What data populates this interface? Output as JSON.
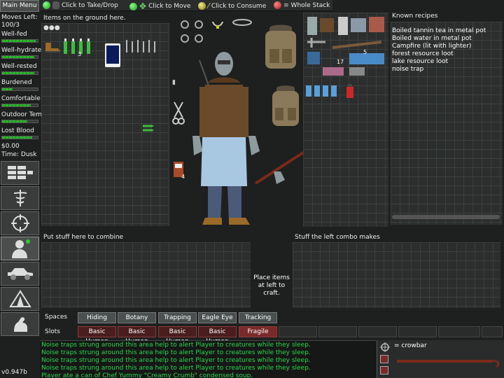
{
  "hints": [
    {
      "label": "Click to Take/Drop",
      "color": "#3bd23b"
    },
    {
      "label": "Click to Move",
      "color": "#3bd23b"
    },
    {
      "label": "Click to Consume",
      "color": "#c9b23a"
    },
    {
      "label": "Whole Stack",
      "color": "#d23b3b"
    }
  ],
  "sidebar": {
    "menu_label": "Main Menu",
    "moves_label": "Moves Left:",
    "moves_value": "100/3",
    "stats": [
      {
        "label": "Well-fed",
        "level": 0.95
      },
      {
        "label": "Well-hydrate",
        "level": 0.9
      },
      {
        "label": "Well-rested",
        "level": 0.9
      },
      {
        "label": "Burdened",
        "level": 0.3
      },
      {
        "label": "Comfortable",
        "level": 0.8
      },
      {
        "label": "Outdoor Tem",
        "level": 0.7
      },
      {
        "label": "Lost Blood",
        "level": 0.85
      }
    ],
    "money": "$0.00",
    "time": "Time: Dusk",
    "buttons": [
      "inventory-icon",
      "medical-icon",
      "target-icon",
      "character-icon",
      "vehicle-icon",
      "camp-icon",
      "strength-icon"
    ],
    "version": "v0.947b"
  },
  "ground": {
    "title": "Items on the ground here."
  },
  "recipes": {
    "title": "Known recipes",
    "items": [
      "Boiled tannin tea in metal pot",
      "Boiled water in metal pot",
      "Campfire (lit with lighter)",
      "forest resource loot",
      "lake resource loot",
      "noise trap"
    ]
  },
  "combine": {
    "left_title": "Put stuff here to combine",
    "right_title": "Stuff the left combo makes",
    "place_hint": "Place items at left to craft."
  },
  "skills": {
    "spaces_label": "Spaces",
    "slots_label": "Slots",
    "spaces": [
      "Hiding",
      "Botany",
      "Trapping",
      "Eagle Eye",
      "Tracking"
    ],
    "slots": [
      "Basic Human",
      "Basic Human",
      "Basic Human",
      "Basic Human",
      "Fragile"
    ]
  },
  "messages": [
    "Noise traps strung around this area help to alert Player to creatures while they sleep.",
    "Noise traps strung around this area help to alert Player to creatures while they sleep.",
    "Noise traps strung around this area help to alert Player to creatures while they sleep.",
    "Noise traps strung around this area help to alert Player to creatures while they sleep.",
    "Player ate a can of Chef Yummy \"Creamy Crumb\" condensed soup."
  ],
  "equipped": {
    "label": "= crowbar"
  },
  "counts": {
    "ground_small": "3",
    "backpack_a": "5",
    "backpack_b": "17",
    "ground_box": "4"
  }
}
